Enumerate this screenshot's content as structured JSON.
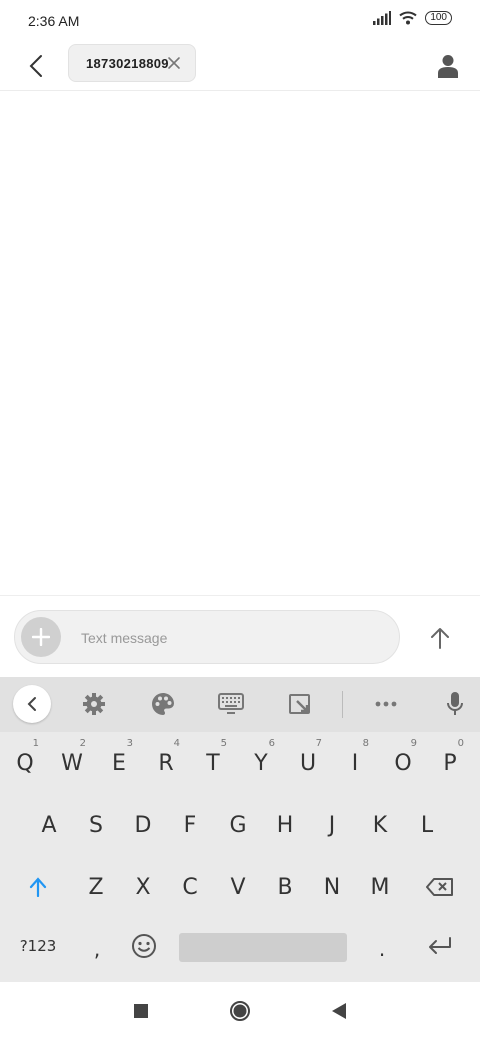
{
  "status": {
    "time": "2:36 AM",
    "battery": "100"
  },
  "header": {
    "recipient": "18730218809"
  },
  "compose": {
    "placeholder": "Text message"
  },
  "keyboard": {
    "row1": [
      {
        "key": "Q",
        "hint": "1"
      },
      {
        "key": "W",
        "hint": "2"
      },
      {
        "key": "E",
        "hint": "3"
      },
      {
        "key": "R",
        "hint": "4"
      },
      {
        "key": "T",
        "hint": "5"
      },
      {
        "key": "Y",
        "hint": "6"
      },
      {
        "key": "U",
        "hint": "7"
      },
      {
        "key": "I",
        "hint": "8"
      },
      {
        "key": "O",
        "hint": "9"
      },
      {
        "key": "P",
        "hint": "0"
      }
    ],
    "row2": [
      "A",
      "S",
      "D",
      "F",
      "G",
      "H",
      "J",
      "K",
      "L"
    ],
    "row3": [
      "Z",
      "X",
      "C",
      "V",
      "B",
      "N",
      "M"
    ],
    "symbols_label": "?123",
    "comma": ",",
    "period": "."
  },
  "colors": {
    "accent": "#2196f3",
    "keyboard_bg": "#eaeaea",
    "toolbar_bg": "#e1e1e1"
  }
}
